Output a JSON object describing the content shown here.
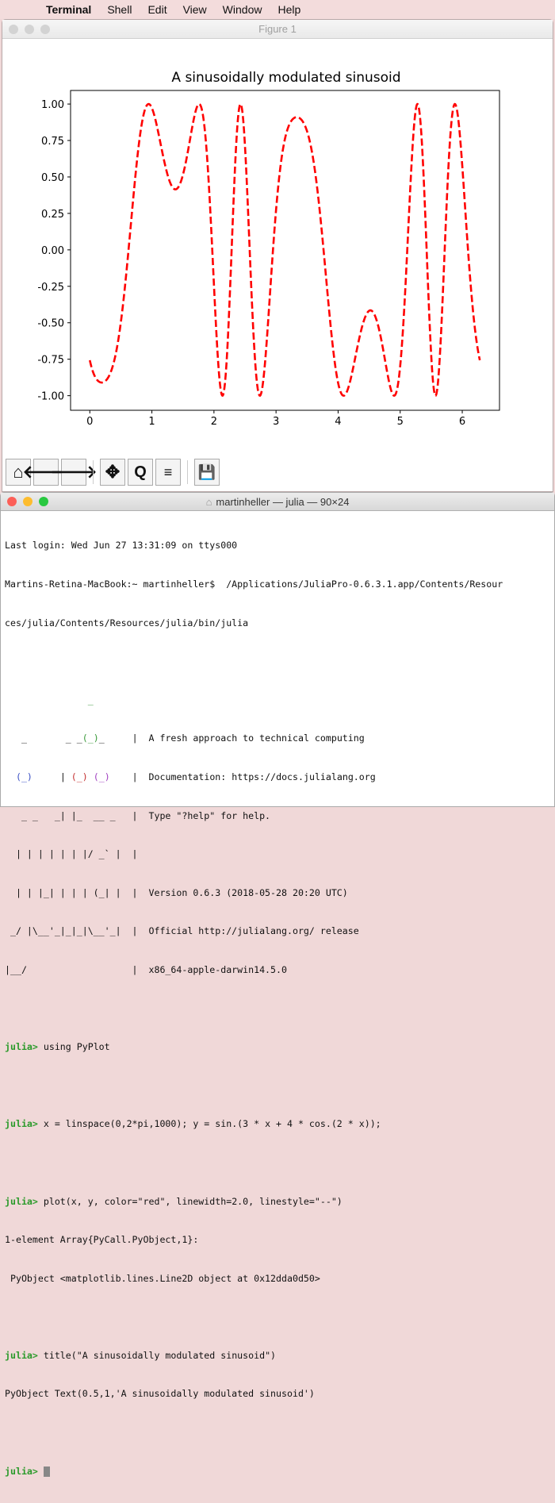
{
  "menubar": {
    "app": "Terminal",
    "items": [
      "Shell",
      "Edit",
      "View",
      "Window",
      "Help"
    ]
  },
  "figure_window": {
    "title": "Figure 1",
    "toolbar": [
      "home-icon",
      "back-arrow-icon",
      "forward-arrow-icon",
      "pan-icon",
      "zoom-icon",
      "configure-subplots-icon",
      "save-icon"
    ]
  },
  "chart_data": {
    "type": "line",
    "title": "A sinusoidally modulated sinusoid",
    "xlabel": "",
    "ylabel": "",
    "function": "y = sin(3x + 4cos(2x))",
    "x_range": [
      0,
      6.283185
    ],
    "n_points": 1000,
    "xlim": [
      -0.31,
      6.6
    ],
    "ylim": [
      -1.1,
      1.093
    ],
    "xticks": [
      "0",
      "1",
      "2",
      "3",
      "4",
      "5",
      "6"
    ],
    "yticks": [
      "1.00",
      "0.75",
      "0.50",
      "0.25",
      "0.00",
      "-0.25",
      "-0.50",
      "-0.75",
      "-1.00"
    ],
    "line_color": "#ff0000",
    "linestyle": "dashed",
    "grid": false
  },
  "terminal": {
    "title": "martinheller — julia — 90×24",
    "lines": [
      "Last login: Wed Jun 27 13:31:09 on ttys000",
      "Martins-Retina-MacBook:~ martinheller$  /Applications/JuliaPro-0.6.3.1.app/Contents/Resour",
      "ces/julia/Contents/Resources/julia/bin/julia"
    ],
    "banner": {
      "l0": "               _",
      "l1a": "   _       _ _",
      "l1b": "(_)",
      "l1c": "_     |  A fresh approach to technical computing",
      "l2a": "  ",
      "l2b": "(_)",
      "l2c": "     | ",
      "l2d": "(_)",
      "l2e": " ",
      "l2f": "(_)",
      "l2g": "    |  Documentation: https://docs.julialang.org",
      "l3": "   _ _   _| |_  __ _   |  Type \"?help\" for help.",
      "l4": "  | | | | | | |/ _` |  |",
      "l5": "  | | |_| | | | (_| |  |  Version 0.6.3 (2018-05-28 20:20 UTC)",
      "l6": " _/ |\\__'_|_|_|\\__'_|  |  Official http://julialang.org/ release",
      "l7": "|__/                   |  x86_64-apple-darwin14.5.0"
    },
    "prompt": "julia>",
    "session": {
      "c1": " using PyPlot",
      "c2": " x = linspace(0,2*pi,1000); y = sin.(3 * x + 4 * cos.(2 * x));",
      "c3": " plot(x, y, color=\"red\", linewidth=2.0, linestyle=\"--\")",
      "o3a": "1-element Array{PyCall.PyObject,1}:",
      "o3b": " PyObject <matplotlib.lines.Line2D object at 0x12dda0d50>",
      "c4": " title(\"A sinusoidally modulated sinusoid\")",
      "o4": "PyObject Text(0.5,1,'A sinusoidally modulated sinusoid')"
    }
  }
}
